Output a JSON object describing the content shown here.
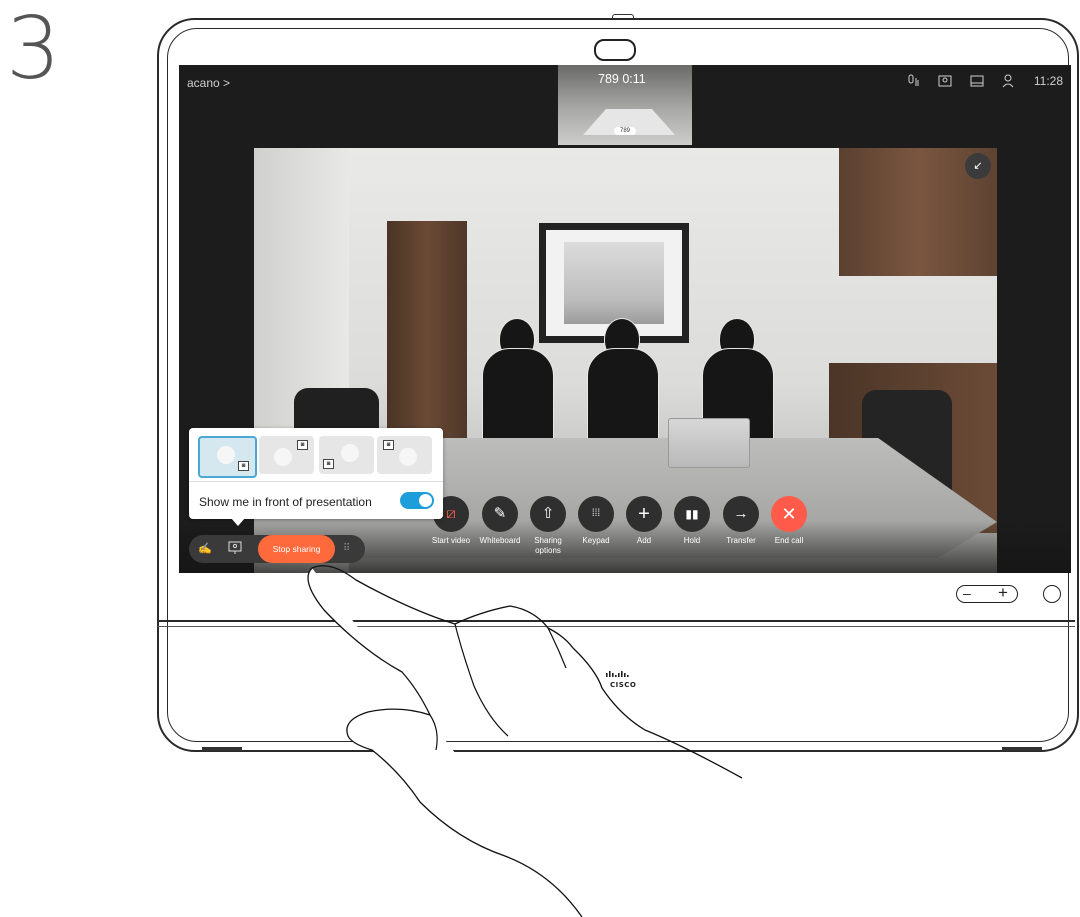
{
  "step": {
    "number": "3"
  },
  "screen": {
    "topbar": {
      "left_label": "acano >",
      "pip_title": "789  0:11",
      "pip_label": "789",
      "time": "11:28",
      "icons": [
        "mic-status-icon",
        "self-view-icon",
        "layout-icon",
        "participants-icon"
      ]
    },
    "controls": [
      {
        "id": "start-video",
        "label": "Start video",
        "icon": "camera-off-icon"
      },
      {
        "id": "whiteboard",
        "label": "Whiteboard",
        "icon": "pencil-icon"
      },
      {
        "id": "sharing-options",
        "label": "Sharing options",
        "icon": "share-icon"
      },
      {
        "id": "keypad",
        "label": "Keypad",
        "icon": "keypad-icon"
      },
      {
        "id": "add",
        "label": "Add",
        "icon": "plus-icon"
      },
      {
        "id": "hold",
        "label": "Hold",
        "icon": "pause-icon"
      },
      {
        "id": "transfer",
        "label": "Transfer",
        "icon": "arrow-right-icon"
      },
      {
        "id": "end-call",
        "label": "End call",
        "icon": "close-icon"
      }
    ],
    "share_bar": {
      "stop_label": "Stop sharing",
      "icons": [
        "annotate-icon",
        "presentation-icon",
        "drag-handle-icon"
      ]
    },
    "popup": {
      "toggle_label": "Show me in front of presentation",
      "toggle_on": true,
      "layouts": [
        "layout-pip-bottom-right",
        "layout-pip-top-right",
        "layout-pip-bottom-left",
        "layout-pip-top-left"
      ],
      "selected_layout": 0
    }
  },
  "device": {
    "brand_icon": "cisco-logo"
  },
  "colors": {
    "accent": "#1e9ddb",
    "stop": "#ff6a3d",
    "end_call": "#ff5a4a"
  }
}
